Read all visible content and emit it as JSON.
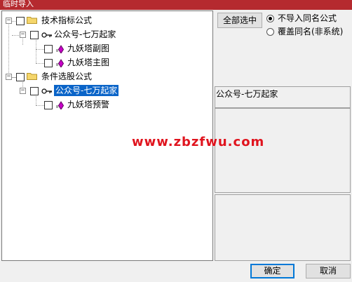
{
  "window": {
    "title": "临时导入"
  },
  "tree": {
    "groups": [
      {
        "label": "技术指标公式",
        "child": {
          "label": "公众号-七万起家",
          "items": [
            "九妖塔副图",
            "九妖塔主图"
          ]
        }
      },
      {
        "label": "条件选股公式",
        "child": {
          "label": "公众号-七万起家",
          "items": [
            "九妖塔预警"
          ]
        }
      }
    ]
  },
  "options": {
    "select_all_label": "全部选中",
    "radio_no_import": "不导入同名公式",
    "radio_overwrite": "覆盖同名(非系统)",
    "selected_radio": "no_import"
  },
  "info": {
    "name": "公众号-七万起家"
  },
  "watermark": "www.zbzfwu.com",
  "buttons": {
    "ok": "确定",
    "cancel": "取消"
  }
}
